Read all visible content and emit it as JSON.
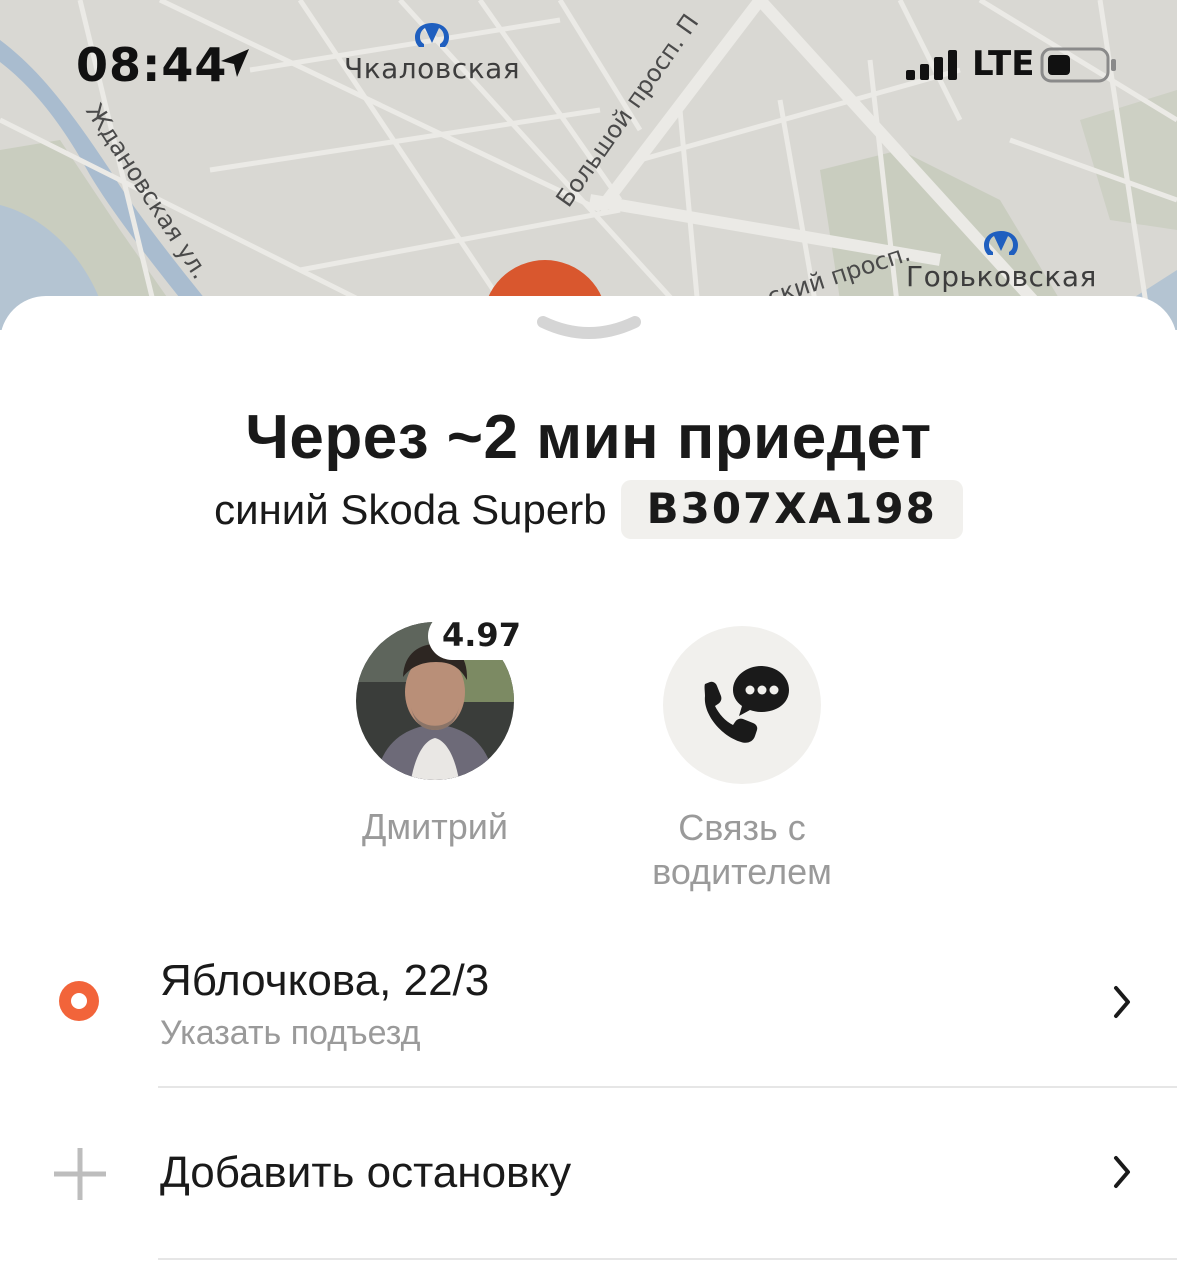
{
  "status_bar": {
    "time": "08:44",
    "network": "LTE",
    "icons": [
      "location-arrow-icon",
      "signal-bars-icon",
      "battery-icon"
    ]
  },
  "map": {
    "metro_stations": [
      {
        "name": "Чкаловская"
      },
      {
        "name": "Горьковская"
      }
    ],
    "streets": [
      "Ждановская ул.",
      "Большой просп. П",
      "ский просп."
    ]
  },
  "ride": {
    "eta_title": "Через ~2 мин приедет",
    "car": "синий Skoda Superb",
    "plate": "В307ХА198"
  },
  "driver": {
    "name": "Дмитрий",
    "rating": "4.97"
  },
  "contact": {
    "label_line1": "Связь с",
    "label_line2": "водителем"
  },
  "route": {
    "pickup": {
      "address": "Яблочкова, 22/3",
      "hint": "Указать подъезд"
    },
    "add_stop": {
      "label": "Добавить остановку"
    }
  },
  "colors": {
    "accent_orange": "#f2643a",
    "plate_bg": "#f1f0ed",
    "secondary_text": "#9a9a9a",
    "map_bg": "#d9d8d3"
  }
}
